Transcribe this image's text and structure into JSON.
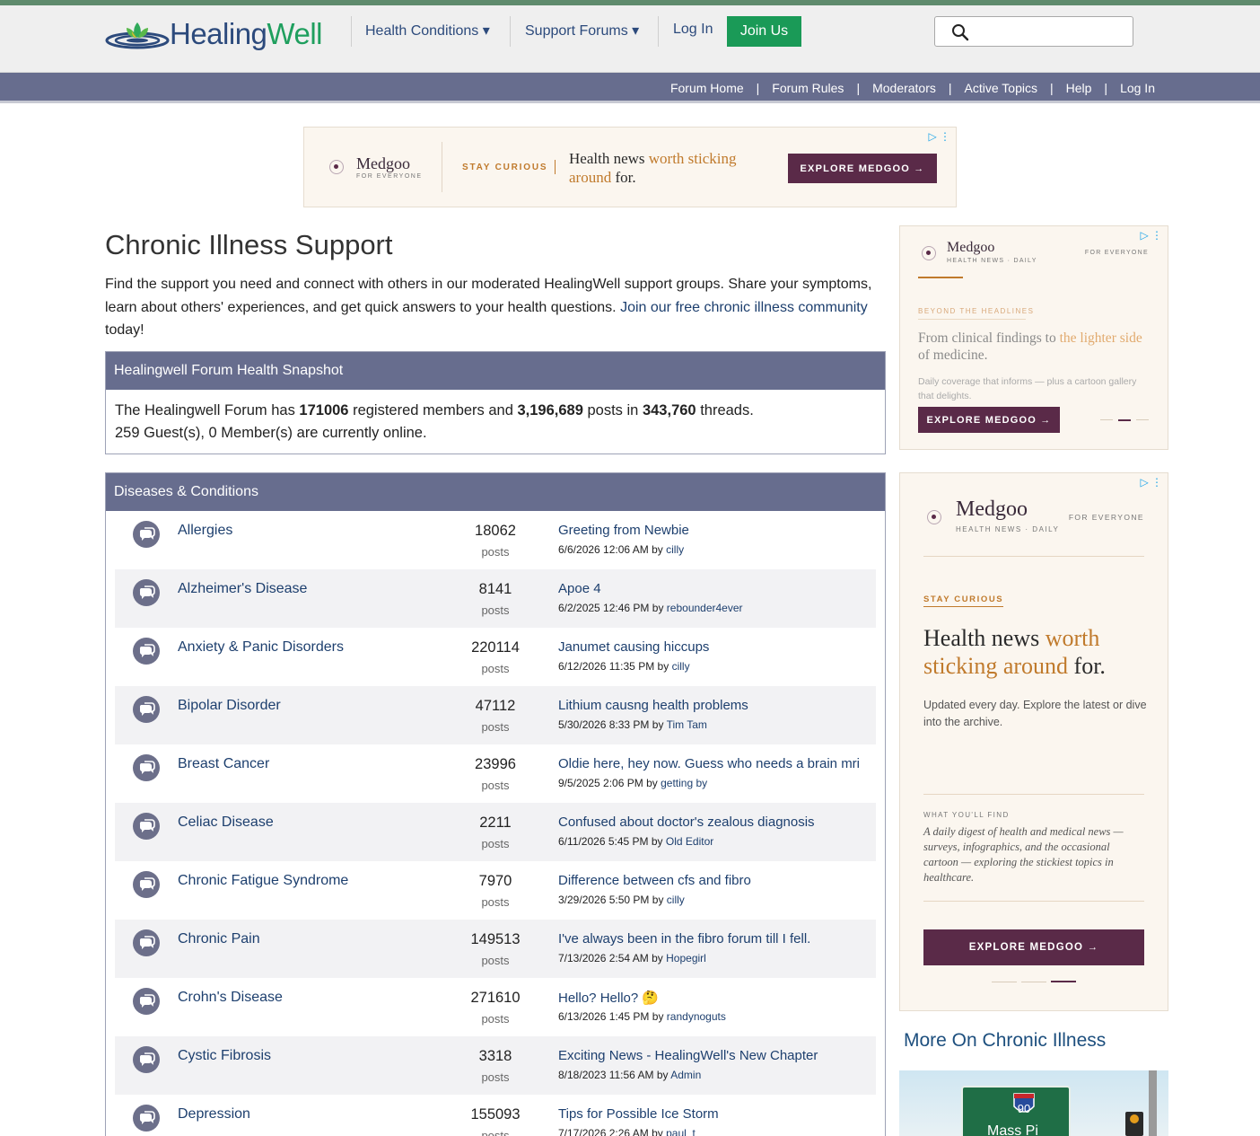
{
  "header": {
    "logo_word_a": "Healing",
    "logo_word_b": "Well",
    "nav": [
      "Health Conditions ▾",
      "Support Forums ▾",
      "Log In"
    ],
    "join_label": "Join Us",
    "search_placeholder": ""
  },
  "subnav": [
    "Forum Home",
    "Forum Rules",
    "Moderators",
    "Active Topics",
    "Help",
    "Log In"
  ],
  "subnav_separator": "|",
  "ad_top": {
    "brand": "Medgoo",
    "brand_sub": "FOR EVERYONE",
    "kicker": "STAY CURIOUS",
    "headline_a": "Health news ",
    "headline_b": "worth sticking",
    "headline_c": "around",
    "headline_d": " for.",
    "cta": "EXPLORE MEDGOO →",
    "adchoice": "▷ ⋮"
  },
  "page": {
    "title": "Chronic Illness Support",
    "intro_text": "Find the support you need and connect with others in our moderated HealingWell support groups. Share your symptoms, learn about others' experiences, and get quick answers to your health questions. ",
    "intro_link": "Join our free chronic illness community",
    "intro_end": " today!"
  },
  "snapshot": {
    "heading": "Healingwell Forum Health Snapshot",
    "t1": "The Healingwell Forum has ",
    "members": "171006",
    "t2": " registered members and ",
    "posts": "3,196,689",
    "t3": " posts in ",
    "threads": "343,760",
    "t4": " threads.",
    "online": "259 Guest(s), 0 Member(s) are currently online."
  },
  "diseases": {
    "heading": "Diseases & Conditions",
    "posts_label": "posts",
    "by_label": "by",
    "rows": [
      {
        "name": "Allergies",
        "count": "18062",
        "topic": "Greeting from Newbie",
        "date": "6/6/2026 12:06 AM",
        "author": "cilly"
      },
      {
        "name": "Alzheimer's Disease",
        "count": "8141",
        "topic": "Apoe 4",
        "date": "6/2/2025 12:46 PM",
        "author": "rebounder4ever"
      },
      {
        "name": "Anxiety & Panic Disorders",
        "count": "220114",
        "topic": "Janumet causing hiccups",
        "date": "6/12/2026 11:35 PM",
        "author": "cilly"
      },
      {
        "name": "Bipolar Disorder",
        "count": "47112",
        "topic": "Lithium causng health problems",
        "date": "5/30/2026 8:33 PM",
        "author": "Tim Tam"
      },
      {
        "name": "Breast Cancer",
        "count": "23996",
        "topic": "Oldie here, hey now. Guess who needs a brain mri",
        "date": "9/5/2025 2:06 PM",
        "author": "getting by"
      },
      {
        "name": "Celiac Disease",
        "count": "2211",
        "topic": "Confused about doctor's zealous diagnosis",
        "date": "6/11/2026 5:45 PM",
        "author": "Old Editor"
      },
      {
        "name": "Chronic Fatigue Syndrome",
        "count": "7970",
        "topic": "Difference between cfs and fibro",
        "date": "3/29/2026 5:50 PM",
        "author": "cilly"
      },
      {
        "name": "Chronic Pain",
        "count": "149513",
        "topic": "I've always been in the fibro forum till I fell.",
        "date": "7/13/2026 2:54 AM",
        "author": "Hopegirl"
      },
      {
        "name": "Crohn's Disease",
        "count": "271610",
        "topic": "Hello? Hello? 🤔",
        "date": "6/13/2026 1:45 PM",
        "author": "randynoguts"
      },
      {
        "name": "Cystic Fibrosis",
        "count": "3318",
        "topic": "Exciting News - HealingWell's New Chapter",
        "date": "8/18/2023 11:56 AM",
        "author": "Admin"
      },
      {
        "name": "Depression",
        "count": "155093",
        "topic": "Tips for Possible Ice Storm",
        "date": "7/17/2026 2:26 AM",
        "author": "paul_t"
      }
    ]
  },
  "ad_side1": {
    "brand": "Medgoo",
    "brand_sub": "HEALTH NEWS · DAILY",
    "for_everyone": "FOR EVERYONE",
    "kicker": "BEYOND THE HEADLINES",
    "headline_a": "From clinical findings to ",
    "headline_b": "the lighter side",
    "headline_c": " of medicine.",
    "body": "Daily coverage that informs — plus a cartoon gallery that delights.",
    "cta": "EXPLORE MEDGOO →",
    "adchoice": "▷ ⋮"
  },
  "ad_side2": {
    "brand": "Medgoo",
    "brand_sub": "HEALTH NEWS · DAILY",
    "for_everyone": "FOR EVERYONE",
    "kicker": "STAY CURIOUS",
    "headline_a": "Health news ",
    "headline_b": "worth sticking around",
    "headline_c": " for.",
    "body": "Updated every day. Explore the latest or dive into the archive.",
    "find_label": "WHAT YOU'LL FIND",
    "find_text": "A daily digest of health and medical news — surveys, infographics, and the occasional cartoon — exploring the stickiest topics in healthcare.",
    "cta": "EXPLORE MEDGOO →",
    "adchoice": "▷ ⋮"
  },
  "more": {
    "title": "More On Chronic Illness",
    "sign_number": "90",
    "sign_text": "Mass Pi"
  },
  "colors": {
    "header_bg": "#efefef",
    "nav_bar": "#676d8e",
    "join_green": "#1a9a57",
    "link_blue": "#1d3f6e",
    "ad_purple": "#5a2a48",
    "ad_gold": "#c07a2c"
  }
}
